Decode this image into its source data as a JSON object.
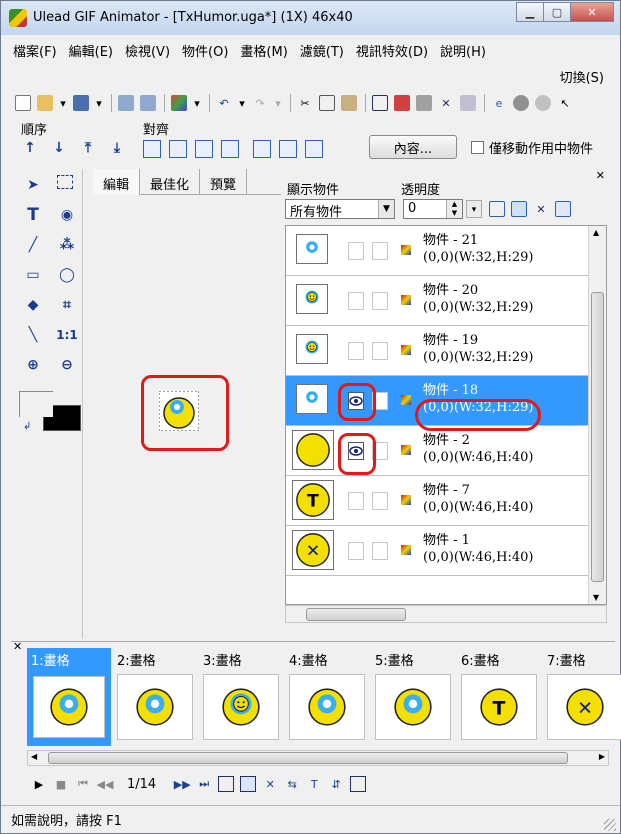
{
  "window": {
    "title": "Ulead GIF Animator - [TxHumor.uga*] (1X) 46x40"
  },
  "menu": [
    "檔案(F)",
    "編輯(E)",
    "檢視(V)",
    "物件(O)",
    "畫格(M)",
    "濾鏡(T)",
    "視訊特效(D)",
    "說明(H)"
  ],
  "switch_label": "切換(S)",
  "toolbar_labels": {
    "order": "順序",
    "align": "對齊"
  },
  "content_button": "內容...",
  "only_move_active": "僅移動作用中物件",
  "canvas_tabs": [
    "編輯",
    "最佳化",
    "預覽"
  ],
  "object_panel": {
    "show_label": "顯示物件",
    "opacity_label": "透明度",
    "filter_value": "所有物件",
    "opacity_value": "0",
    "rows": [
      {
        "name": "物件 - 21",
        "dims": "(0,0)(W:32,H:29)",
        "icon": "sun-flower-icon"
      },
      {
        "name": "物件 - 20",
        "dims": "(0,0)(W:32,H:29)",
        "icon": "smiley-flower-icon"
      },
      {
        "name": "物件 - 19",
        "dims": "(0,0)(W:32,H:29)",
        "icon": "smiley-flower-icon"
      },
      {
        "name": "物件 - 18",
        "dims": "(0,0)(W:32,H:29)",
        "icon": "flower-icon",
        "selected": true
      },
      {
        "name": "物件 - 2",
        "dims": "(0,0)(W:46,H:40)",
        "icon": "yellow-circle-icon"
      },
      {
        "name": "物件 - 7",
        "dims": "(0,0)(W:46,H:40)",
        "icon": "t-circle-icon"
      },
      {
        "name": "物件 - 1",
        "dims": "(0,0)(W:46,H:40)",
        "icon": "x-circle-icon"
      }
    ]
  },
  "frames": [
    {
      "label": "1:畫格",
      "active": true,
      "icon": "flower-coin-icon"
    },
    {
      "label": "2:畫格",
      "icon": "flower-coin-icon"
    },
    {
      "label": "3:畫格",
      "icon": "smiley-coin-icon"
    },
    {
      "label": "4:畫格",
      "icon": "flower-coin-icon"
    },
    {
      "label": "5:畫格",
      "icon": "flower-coin-icon"
    },
    {
      "label": "6:畫格",
      "icon": "t-coin-icon"
    },
    {
      "label": "7:畫格",
      "icon": "x-coin-icon"
    }
  ],
  "frame_counter": "1/14",
  "status_text": "如需說明，請按 F1",
  "colors": {
    "selection": "#3399ff",
    "highlight": "#e01a1a",
    "coin": "#f4e000"
  }
}
